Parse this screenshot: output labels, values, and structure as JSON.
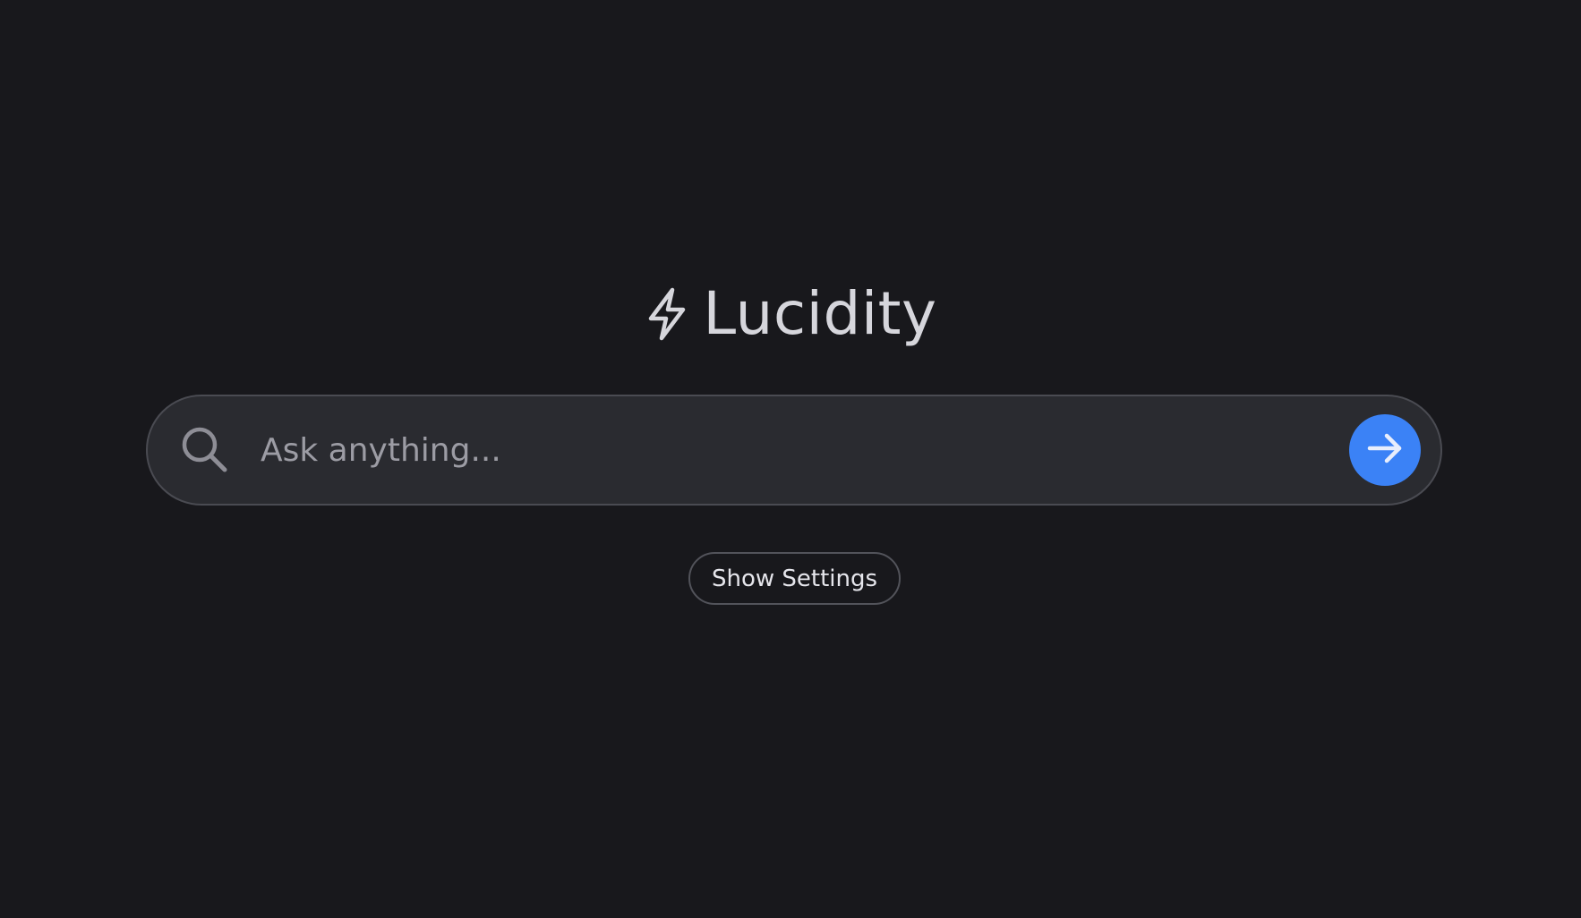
{
  "app": {
    "title": "Lucidity",
    "logo_icon": "lightning-bolt-icon"
  },
  "search": {
    "placeholder": "Ask anything...",
    "value": "",
    "icon": "search-icon",
    "submit_icon": "arrow-right-icon"
  },
  "settings": {
    "toggle_label": "Show Settings"
  },
  "colors": {
    "background": "#18181c",
    "search_background": "#2a2b30",
    "accent": "#3b82f6",
    "text_primary": "#d6d6dc",
    "placeholder": "#9c9ca4"
  }
}
